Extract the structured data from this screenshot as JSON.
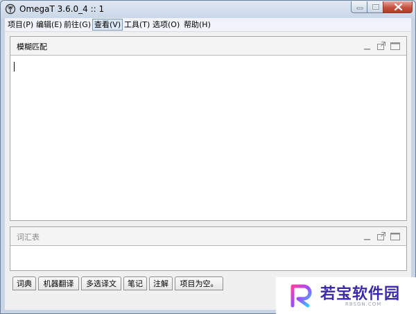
{
  "window": {
    "title": "OmegaT 3.6.0_4 :: 1"
  },
  "menu": [
    {
      "label": "项目(P)"
    },
    {
      "label": "编辑(E)"
    },
    {
      "label": "前往(G)"
    },
    {
      "label": "查看(V)"
    },
    {
      "label": "工具(T)"
    },
    {
      "label": "选项(O)"
    },
    {
      "label": "帮助(H)"
    }
  ],
  "panels": {
    "fuzzy": {
      "title": "模糊匹配"
    },
    "glossary": {
      "title": "词汇表"
    }
  },
  "tabs": [
    {
      "label": "词典"
    },
    {
      "label": "机器翻译"
    },
    {
      "label": "多选译文"
    },
    {
      "label": "笔记"
    },
    {
      "label": "注解"
    },
    {
      "label": "项目为空。"
    }
  ],
  "watermark": {
    "brand": "若宝软件园",
    "url": "RBSGN.COM"
  }
}
